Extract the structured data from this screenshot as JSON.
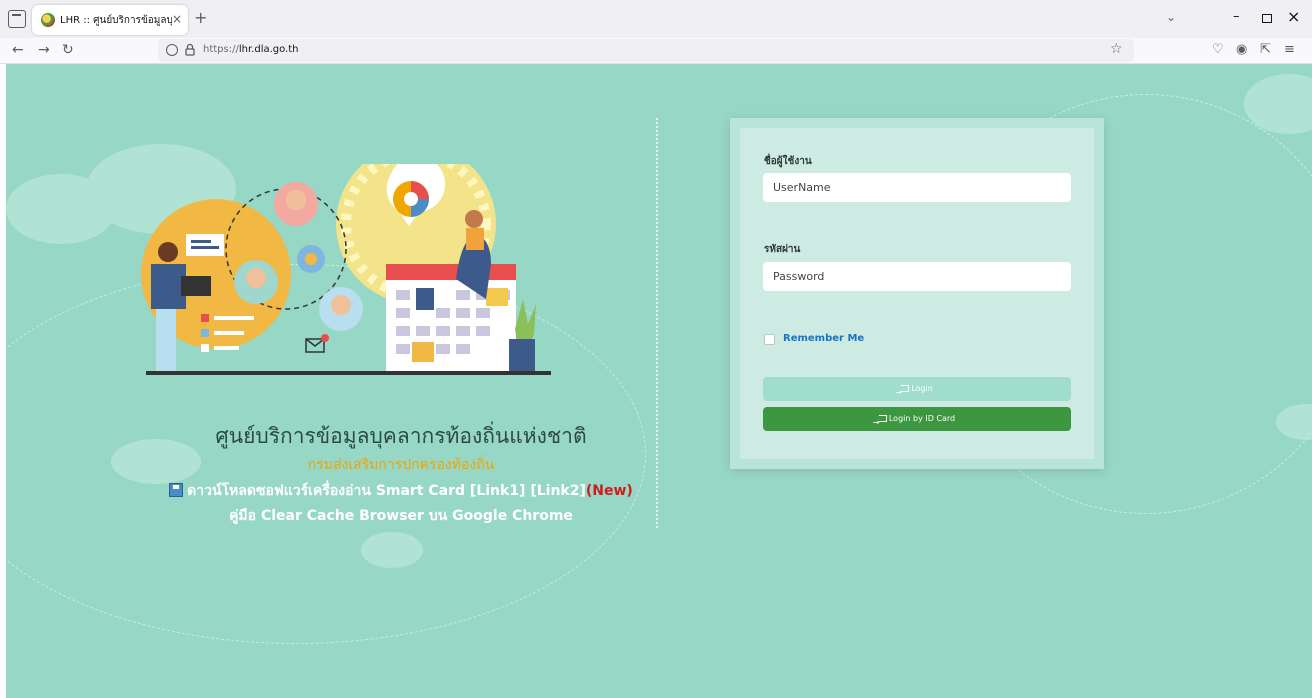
{
  "browser": {
    "tab_title": "LHR :: ศูนย์บริการข้อมูลบุคลากรท้",
    "tab_close": "×",
    "new_tab": "+",
    "tabs_list": "⌄",
    "win_min": "–",
    "win_close": "×",
    "url_prefix": "https://",
    "url_domain": "lhr.dla.go.th",
    "bookmark": "☆"
  },
  "header": {
    "title": "ศูนย์บริการข้อมูลบุคลากรท้องถิ่นแห่งชาติ",
    "subtitle": "กรมส่งเสริมการปกครองท้องถิ่น",
    "download_text": "ดาวน์โหลดซอฟแวร์เครื่องอ่าน Smart Card [Link1] [Link2]",
    "download_new": "(New)",
    "manual_text": "คู่มือ Clear Cache Browser บน Google Chrome"
  },
  "login": {
    "username_label": "ชื่อผู้ใช้งาน",
    "username_placeholder": "UserName",
    "password_label": "รหัสผ่าน",
    "password_placeholder": "Password",
    "remember_label": "Remember Me",
    "login_button": "Login",
    "idcard_button": "Login by ID Card"
  },
  "colors": {
    "background": "#97d7c6",
    "accent_green": "#3d9640",
    "subtitle_orange": "#f0a500",
    "new_red": "#d11a1a",
    "remember_blue": "#1a73c8"
  }
}
